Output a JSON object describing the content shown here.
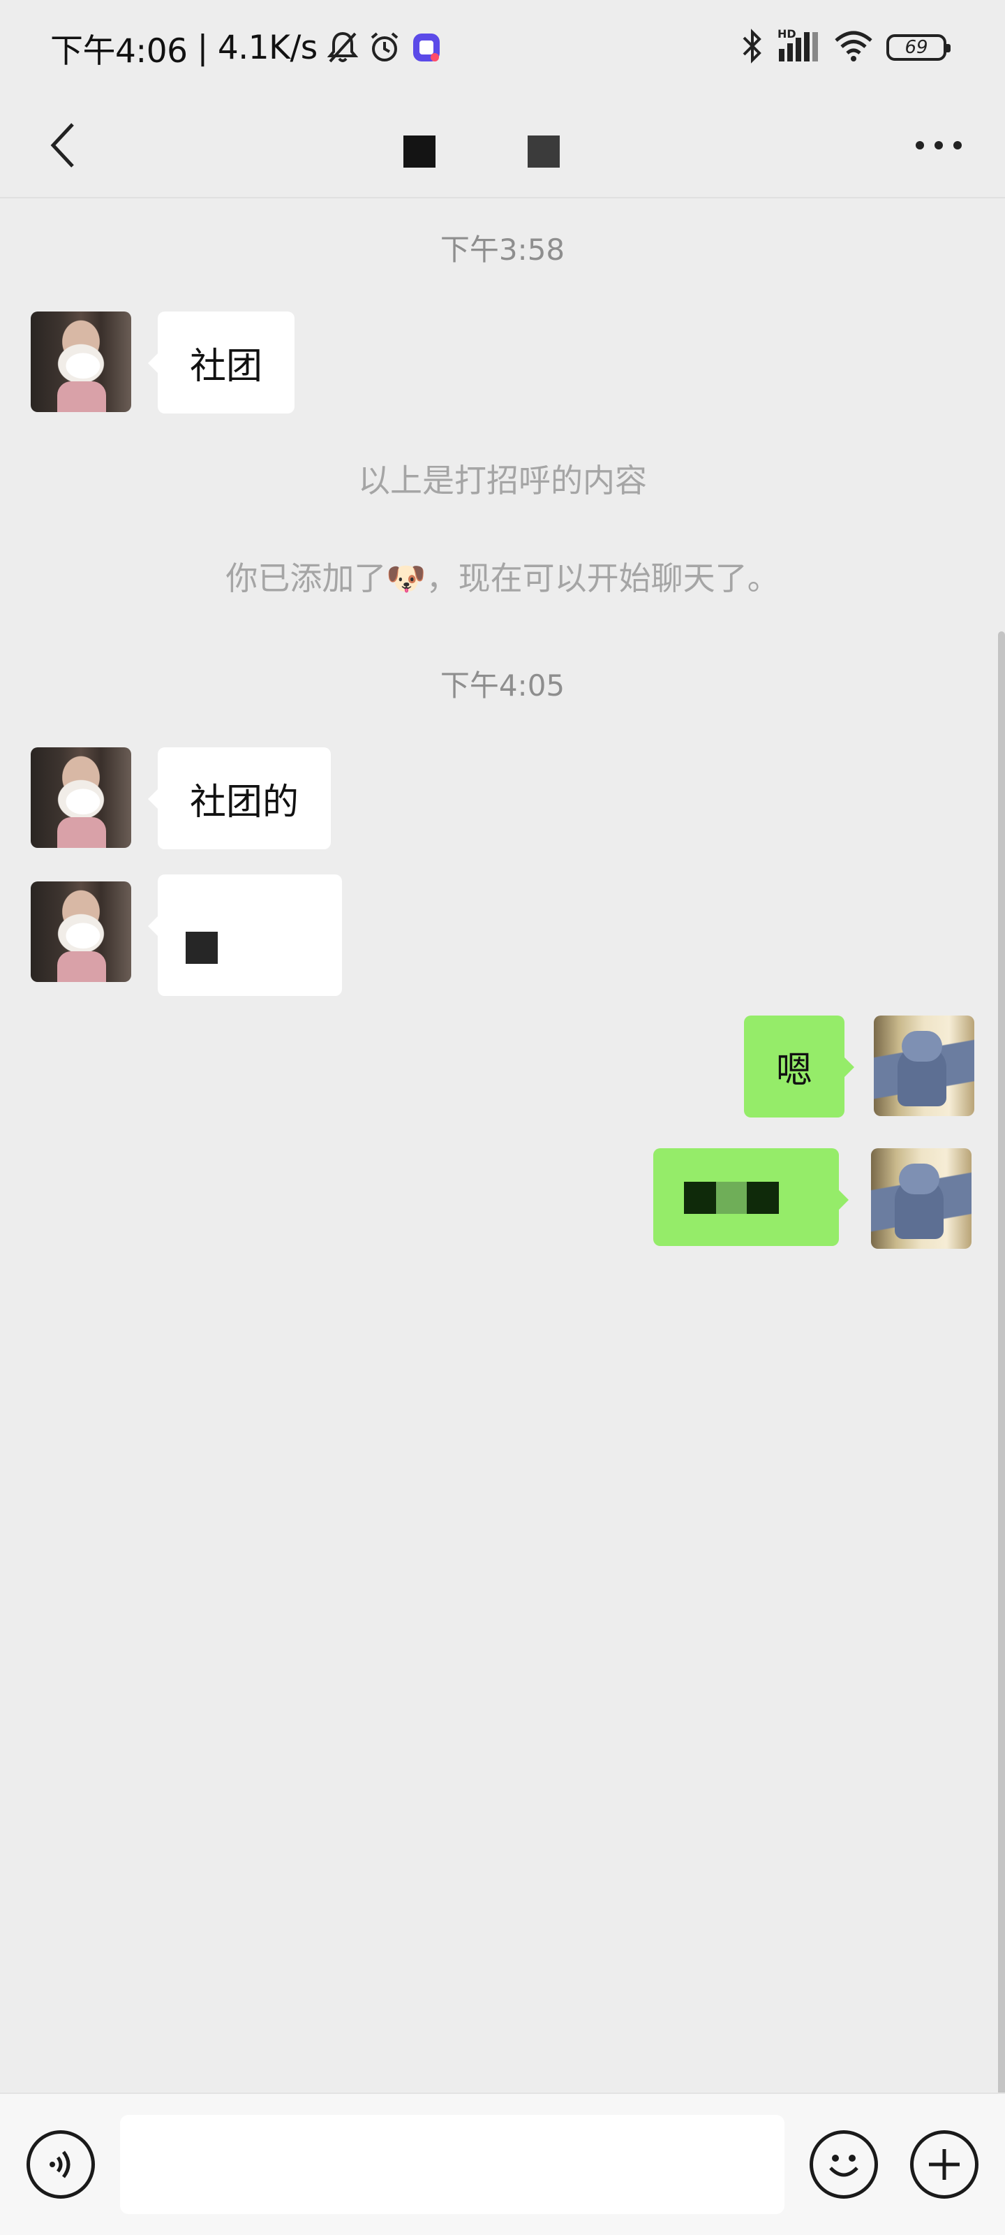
{
  "status_bar": {
    "time": "下午4:06",
    "separator": "|",
    "speed": "4.1K/s",
    "hd_label": "HD",
    "battery": "69",
    "icons": [
      "mute-bell-icon",
      "alarm-icon",
      "app-badge-icon",
      "bluetooth-icon",
      "signal-icon",
      "wifi-icon",
      "battery-icon"
    ]
  },
  "nav": {
    "back_icon": "chevron-left-icon",
    "more_icon": "more-dots-icon"
  },
  "messages": {
    "time_1": "下午3:58",
    "msg_1": "社团",
    "sys_1": "以上是打招呼的内容",
    "sys_2_prefix": "你已添加了",
    "sys_2_emoji": "🐶",
    "sys_2_suffix": "，现在可以开始聊天了。",
    "time_2": "下午4:05",
    "msg_2": "社团的",
    "msg_4": "嗯"
  },
  "input_bar": {
    "voice_icon": "voice-icon",
    "emoji_icon": "emoji-icon",
    "plus_icon": "plus-icon",
    "placeholder": ""
  },
  "colors": {
    "background": "#ededed",
    "bubble_incoming": "#ffffff",
    "bubble_outgoing": "#95ec69",
    "timestamp": "#8e8e8e"
  }
}
